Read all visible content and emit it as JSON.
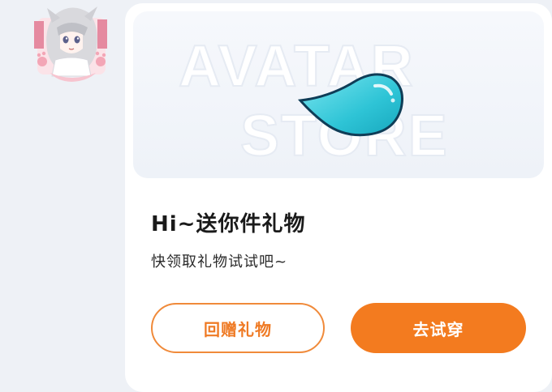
{
  "avatar": {
    "icon": "anime-avatar-icon",
    "accent_pink": "#f3a6b6"
  },
  "banner": {
    "watermark_line1": "AVATAR",
    "watermark_line2": "STORE",
    "gift_icon": "teal-drop-icon",
    "gift_color": "#2ec4d6"
  },
  "gift": {
    "title": "Hi~送你件礼物",
    "subtitle": "快领取礼物试试吧~"
  },
  "buttons": {
    "return_gift": "回赠礼物",
    "try_on": "去试穿"
  },
  "colors": {
    "accent": "#f37b1f",
    "background": "#eef1f6"
  }
}
